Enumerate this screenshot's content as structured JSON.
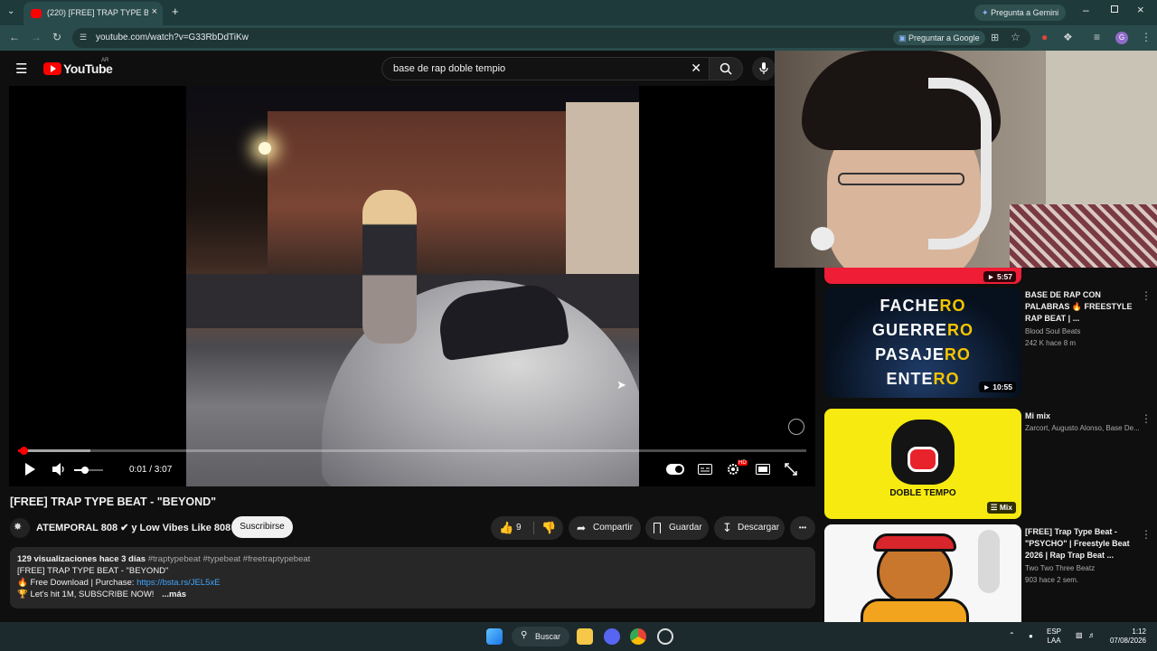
{
  "browser": {
    "tab_title": "(220) [FREE] TRAP TYPE BEAT - ...",
    "url": "youtube.com/watch?v=G33RbDdTiKw",
    "gemini_label": "Pregunta a Gemini",
    "google_label": "Preguntar a Google"
  },
  "header": {
    "logo_text": "YouTube",
    "country_code": "AR",
    "search_value": "base de rap doble tempio"
  },
  "player": {
    "time": "0:01 / 3:07",
    "progress_fraction": 0.005,
    "volume_fraction": 0.3,
    "hd_badge": "HD"
  },
  "video": {
    "title": "[FREE] TRAP TYPE BEAT - \"BEYOND\"",
    "channel": "ATEMPORAL 808 ✔ y Low Vibes Like 808",
    "subscribe": "Suscribirse",
    "likes": "9",
    "share": "Compartir",
    "save": "Guardar",
    "download": "Descargar",
    "more": "•••"
  },
  "description": {
    "stats": "129 visualizaciones  hace 3 días",
    "tags": "#traptypebeat #typebeat #freetraptypebeat",
    "line2": "[FREE] TRAP TYPE BEAT - \"BEYOND\"",
    "line3_prefix": "🔥 Free Download | Purchase: ",
    "line3_link": "https://bsta.rs/JEL5xE",
    "line4": "🏆 Let's hit 1M, SUBSCRIBE NOW!",
    "more": "...más"
  },
  "sidebar": {
    "items": [
      {
        "duration": "5:57"
      },
      {
        "title": "BASE DE RAP CON PALABRAS 🔥 FREESTYLE RAP BEAT | ...",
        "channel": "Blood Soul Beats",
        "meta": "242 K  hace 8 m",
        "duration": "10:55",
        "thumb_words": [
          "FACHE",
          "RO",
          "GUERRE",
          "RO",
          "PASAJE",
          "RO",
          "ENTE",
          "RO"
        ]
      },
      {
        "title": "Mi mix",
        "channel": "Zarcort, Augusto Alonso, Base De...",
        "thumb_text": "DOBLE TEMPO",
        "badge": "Mix"
      },
      {
        "title": "[FREE] Trap Type Beat - \"PSYCHO\" | Freestyle Beat 2026 | Rap Trap Beat ...",
        "channel": "Two Two Three Beatz",
        "meta": "903  hace 2 sem."
      }
    ]
  },
  "taskbar": {
    "search_label": "Buscar",
    "lang_top": "ESP",
    "lang_bottom": "LAA",
    "time": "1:12",
    "date": "07/08/2026"
  },
  "colors": {
    "accent_red": "#ff0000",
    "background": "#0f0f0f",
    "link_blue": "#3ea6ff"
  }
}
